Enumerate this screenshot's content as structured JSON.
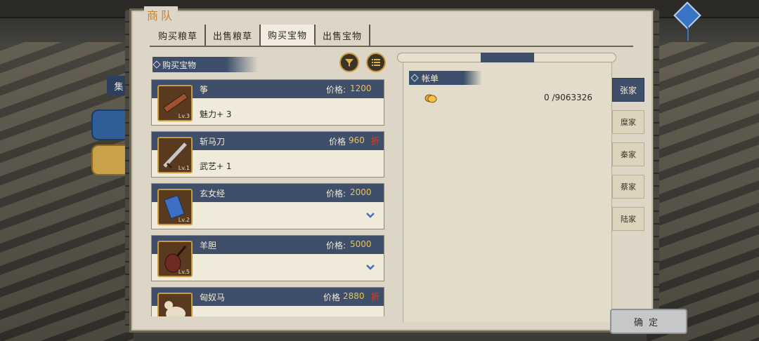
{
  "window": {
    "title": "商队"
  },
  "tabs": [
    {
      "label": "购买粮草",
      "active": false
    },
    {
      "label": "出售粮草",
      "active": false
    },
    {
      "label": "购买宝物",
      "active": true
    },
    {
      "label": "出售宝物",
      "active": false
    }
  ],
  "left_side": {
    "tab_label": "集"
  },
  "section": {
    "title": "购买宝物"
  },
  "items": [
    {
      "name": "筝",
      "price_label": "价格:",
      "price": "1200",
      "level": "Lv.3",
      "attr": "魅力+ 3",
      "flag": "",
      "expand": false,
      "icon": "zither-icon"
    },
    {
      "name": "斩马刀",
      "price_label": "价格",
      "price": "960",
      "level": "Lv.1",
      "attr": "武艺+ 1",
      "flag": "折",
      "expand": false,
      "icon": "sword-icon"
    },
    {
      "name": "玄女经",
      "price_label": "价格:",
      "price": "2000",
      "level": "Lv.2",
      "attr": "",
      "flag": "",
      "expand": true,
      "icon": "book-icon"
    },
    {
      "name": "羊胆",
      "price_label": "价格:",
      "price": "5000",
      "level": "Lv.5",
      "attr": "",
      "flag": "",
      "expand": true,
      "icon": "lute-icon"
    },
    {
      "name": "匈奴马",
      "price_label": "价格",
      "price": "2880",
      "level": "",
      "attr": "",
      "flag": "折",
      "expand": false,
      "icon": "horse-icon"
    }
  ],
  "ledger": {
    "title": "帐单",
    "amount": "0 /9063326",
    "icon": "coin-icon"
  },
  "families": [
    {
      "label": "张家",
      "active": true
    },
    {
      "label": "糜家",
      "active": false
    },
    {
      "label": "秦家",
      "active": false
    },
    {
      "label": "蔡家",
      "active": false
    },
    {
      "label": "陆家",
      "active": false
    }
  ],
  "confirm": {
    "label": "确定"
  },
  "colors": {
    "header_blue": "#3f4f69",
    "price_gold": "#f0c24a",
    "title_orange": "#c6813a",
    "parchment": "#ddd6c6"
  }
}
